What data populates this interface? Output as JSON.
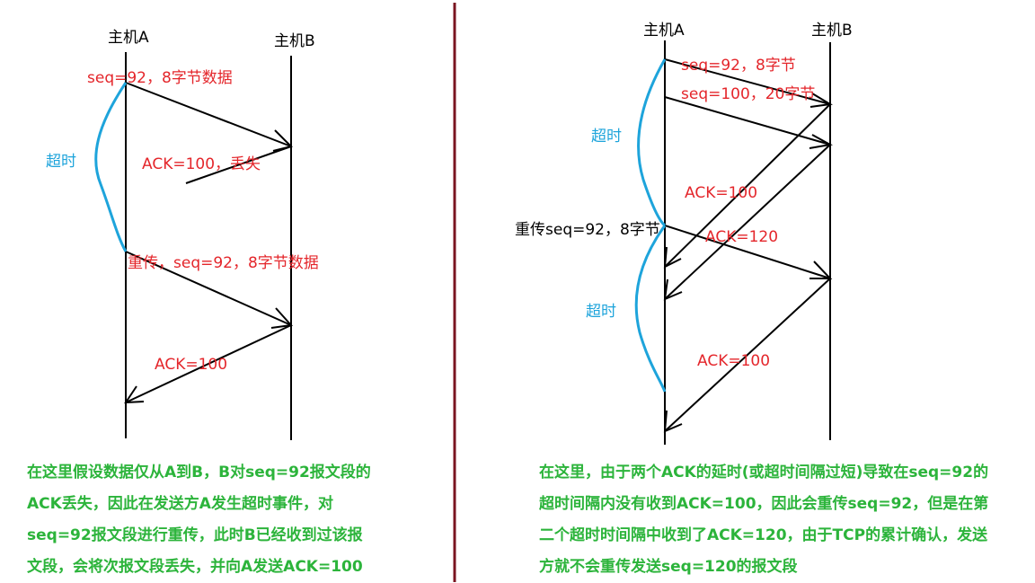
{
  "left": {
    "host_a": "主机A",
    "host_b": "主机B",
    "labels": {
      "send1": "seq=92，8字节数据",
      "ack_lost": "ACK=100，丢失",
      "timeout": "超时",
      "resend": "重传，seq=92，8字节数据",
      "ack2": "ACK=100"
    },
    "note": [
      "在这里假设数据仅从A到B，B对seq=92报文段的",
      "ACK丢失，因此在发送方A发生超时事件，对",
      "seq=92报文段进行重传，此时B已经收到过该报",
      "文段，会将次报文段丢失，并向A发送ACK=100"
    ]
  },
  "right": {
    "host_a": "主机A",
    "host_b": "主机B",
    "labels": {
      "send1": "seq=92，8字节",
      "send2": "seq=100，20字节",
      "timeout1": "超时",
      "ack100": "ACK=100",
      "resend": "重传seq=92，8字节",
      "ack120": "ACK=120",
      "timeout2": "超时",
      "ack100b": "ACK=100"
    },
    "note": [
      "在这里，由于两个ACK的延时(或超时间隔过短)导致在seq=92的",
      "超时间隔内没有收到ACK=100，因此会重传seq=92，但是在第",
      "二个超时时间隔中收到了ACK=120，由于TCP的累计确认，发送",
      "方就不会重传发送seq=120的报文段"
    ]
  },
  "colors": {
    "arrow": "#000000",
    "label": "#e4262b",
    "timeout": "#1ea4db",
    "note": "#2cb43b",
    "divider": "#7a1420"
  }
}
